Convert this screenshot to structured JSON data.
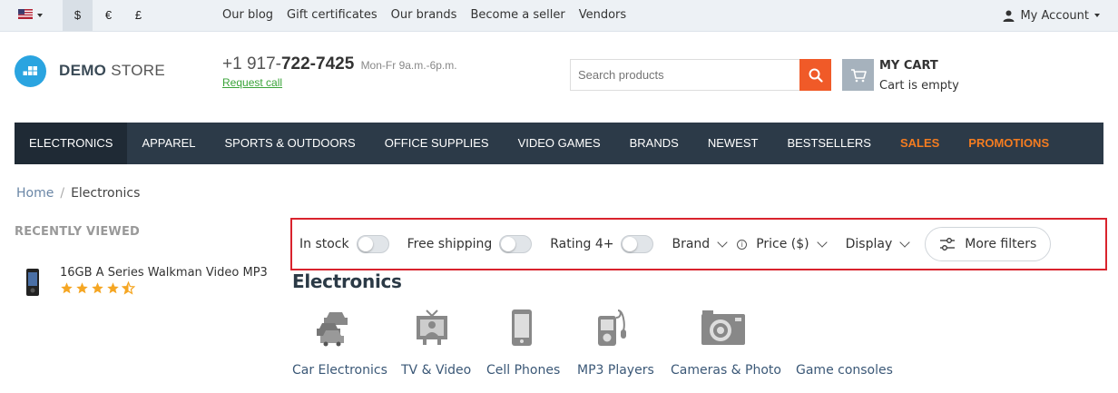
{
  "topbar": {
    "currencies": [
      "$",
      "€",
      "£"
    ],
    "active_currency": "$",
    "links": [
      "Our blog",
      "Gift certificates",
      "Our brands",
      "Become a seller",
      "Vendors"
    ],
    "account_label": "My Account"
  },
  "header": {
    "logo_bold": "DEMO",
    "logo_light": "STORE",
    "phone_prefix": "+1 917-",
    "phone_main": "722-7425",
    "hours": "Mon-Fr 9a.m.-6p.m.",
    "request_call": "Request call",
    "search_placeholder": "Search products",
    "cart_title": "MY CART",
    "cart_status": "Cart is empty",
    "accent_color": "#f05a28",
    "brand_color": "#2aa4e0"
  },
  "nav": {
    "items": [
      "ELECTRONICS",
      "APPAREL",
      "SPORTS & OUTDOORS",
      "OFFICE SUPPLIES",
      "VIDEO GAMES",
      "BRANDS",
      "NEWEST",
      "BESTSELLERS",
      "SALES",
      "PROMOTIONS"
    ],
    "active": "ELECTRONICS",
    "highlight_color": "#f47c20"
  },
  "breadcrumb": {
    "home": "Home",
    "separator": "/",
    "current": "Electronics"
  },
  "recently_viewed": {
    "title": "RECENTLY VIEWED",
    "product_name": "16GB A Series Walkman Video MP3",
    "rating": 4.5
  },
  "filters": {
    "in_stock": "In stock",
    "free_shipping": "Free shipping",
    "rating": "Rating 4+",
    "brand": "Brand",
    "price": "Price ($)",
    "display": "Display",
    "more_filters": "More filters"
  },
  "page_title": "Electronics",
  "categories": [
    {
      "label": "Car Electronics",
      "icon": "car-icon"
    },
    {
      "label": "TV & Video",
      "icon": "tv-icon"
    },
    {
      "label": "Cell Phones",
      "icon": "phone-icon"
    },
    {
      "label": "MP3 Players",
      "icon": "mp3-player-icon"
    },
    {
      "label": "Cameras & Photo",
      "icon": "camera-icon"
    },
    {
      "label": "Game consoles",
      "icon": "console-icon"
    }
  ]
}
